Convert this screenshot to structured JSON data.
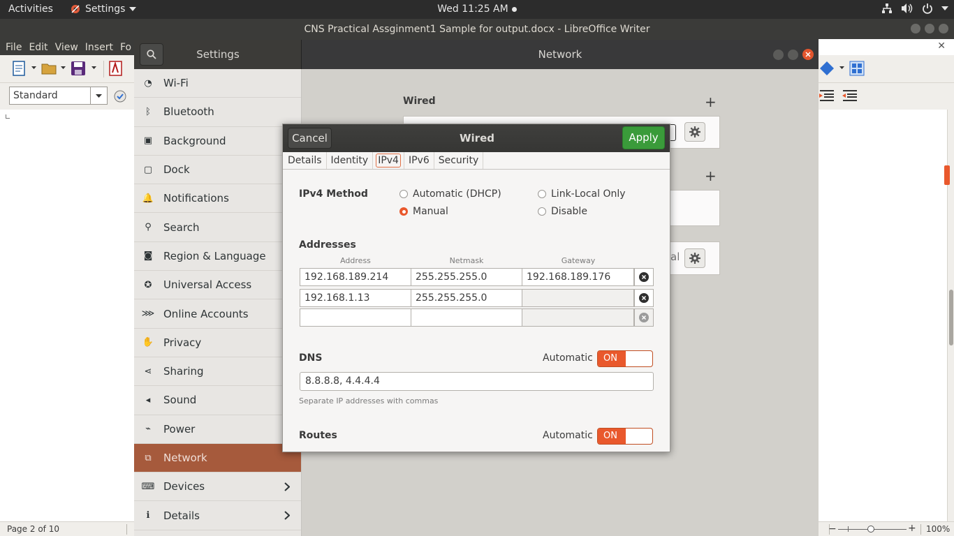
{
  "topbar": {
    "activities": "Activities",
    "app_menu": "Settings",
    "clock": "Wed 11:25 AM"
  },
  "writer": {
    "window_title": "CNS Practical Assginment1 Sample for output.docx - LibreOffice Writer",
    "menu": [
      "File",
      "Edit",
      "View",
      "Insert",
      "Fo"
    ],
    "paragraph_style": "Standard",
    "status": {
      "page": "Page 2 of 10",
      "zoom": "100%"
    }
  },
  "settings": {
    "title": "Settings",
    "panel_title": "Network",
    "sidebar": [
      {
        "label": "Wi-Fi",
        "icon": "wifi-icon"
      },
      {
        "label": "Bluetooth",
        "icon": "bluetooth-icon"
      },
      {
        "label": "Background",
        "icon": "background-icon"
      },
      {
        "label": "Dock",
        "icon": "dock-icon"
      },
      {
        "label": "Notifications",
        "icon": "bell-icon"
      },
      {
        "label": "Search",
        "icon": "search-icon"
      },
      {
        "label": "Region & Language",
        "icon": "camera-icon"
      },
      {
        "label": "Universal Access",
        "icon": "accessibility-icon"
      },
      {
        "label": "Online Accounts",
        "icon": "online-accounts-icon"
      },
      {
        "label": "Privacy",
        "icon": "hand-icon"
      },
      {
        "label": "Sharing",
        "icon": "share-icon"
      },
      {
        "label": "Sound",
        "icon": "speaker-icon"
      },
      {
        "label": "Power",
        "icon": "power-plug-icon"
      },
      {
        "label": "Network",
        "icon": "network-icon",
        "active": true
      },
      {
        "label": "Devices",
        "icon": "devices-icon",
        "chevron": true
      },
      {
        "label": "Details",
        "icon": "info-icon",
        "chevron": true
      }
    ],
    "network": {
      "wired_heading": "Wired",
      "partial_text": "al"
    }
  },
  "dialog": {
    "title": "Wired",
    "cancel_label": "Cancel",
    "apply_label": "Apply",
    "tabs": [
      "Details",
      "Identity",
      "IPv4",
      "IPv6",
      "Security"
    ],
    "active_tab": "IPv4",
    "ipv4_method_label": "IPv4 Method",
    "methods": {
      "automatic": "Automatic (DHCP)",
      "link_local": "Link-Local Only",
      "manual": "Manual",
      "disable": "Disable"
    },
    "selected_method": "Manual",
    "addresses_label": "Addresses",
    "columns": {
      "address": "Address",
      "netmask": "Netmask",
      "gateway": "Gateway"
    },
    "addresses": [
      {
        "address": "192.168.189.214",
        "netmask": "255.255.255.0",
        "gateway": "192.168.189.176"
      },
      {
        "address": "192.168.1.13",
        "netmask": "255.255.255.0",
        "gateway": ""
      },
      {
        "address": "",
        "netmask": "",
        "gateway": ""
      }
    ],
    "dns": {
      "label": "DNS",
      "automatic_label": "Automatic",
      "toggle": "ON",
      "value": "8.8.8.8, 4.4.4.4",
      "hint": "Separate IP addresses with commas"
    },
    "routes": {
      "label": "Routes",
      "automatic_label": "Automatic",
      "toggle": "ON"
    }
  },
  "colors": {
    "accent": "#e9582c",
    "apply_green": "#3a9b3a",
    "sidebar_active": "#a65a3c"
  }
}
